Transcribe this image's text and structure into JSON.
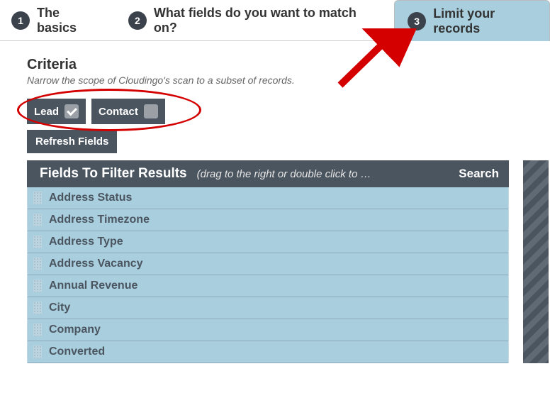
{
  "tabs": [
    {
      "num": "1",
      "label": "The basics"
    },
    {
      "num": "2",
      "label": "What fields do you want to match on?"
    },
    {
      "num": "3",
      "label": "Limit your records"
    }
  ],
  "criteria": {
    "title": "Criteria",
    "subtitle": "Narrow the scope of Cloudingo's scan to a subset of records."
  },
  "toggles": {
    "lead": "Lead",
    "contact": "Contact",
    "refresh": "Refresh Fields"
  },
  "panel": {
    "title": "Fields To Filter Results",
    "hint": "(drag to the right or double click to …",
    "search": "Search"
  },
  "fields": [
    "Address Status",
    "Address Timezone",
    "Address Type",
    "Address Vacancy",
    "Annual Revenue",
    "City",
    "Company",
    "Converted"
  ]
}
